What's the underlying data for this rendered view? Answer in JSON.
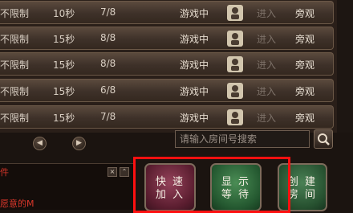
{
  "rooms": [
    {
      "limit": "不限制",
      "time": "10秒",
      "players": "7/8",
      "status": "游戏中",
      "enter": "进入",
      "watch": "旁观"
    },
    {
      "limit": "不限制",
      "time": "15秒",
      "players": "8/8",
      "status": "游戏中",
      "enter": "进入",
      "watch": "旁观"
    },
    {
      "limit": "不限制",
      "time": "15秒",
      "players": "8/8",
      "status": "游戏中",
      "enter": "进入",
      "watch": "旁观"
    },
    {
      "limit": "不限制",
      "time": "15秒",
      "players": "6/8",
      "status": "游戏中",
      "enter": "进入",
      "watch": "旁观"
    },
    {
      "limit": "不限制",
      "time": "15秒",
      "players": "7/8",
      "status": "游戏中",
      "enter": "进入",
      "watch": "旁观"
    }
  ],
  "pager": {
    "prev_icon": "arrow-left-icon",
    "next_icon": "arrow-right-icon"
  },
  "search": {
    "placeholder": "请输入房间号搜索",
    "icon": "search-icon"
  },
  "chat": {
    "label": "件",
    "message": "愿意的M"
  },
  "actions": {
    "quick_join": [
      "快 速",
      "加 入"
    ],
    "show_waiting": [
      "显 示",
      "等 待"
    ],
    "create_room": [
      "创 建",
      "房 间"
    ]
  },
  "colors": {
    "highlight": "#ff1010",
    "chat_text": "#d8362a"
  }
}
